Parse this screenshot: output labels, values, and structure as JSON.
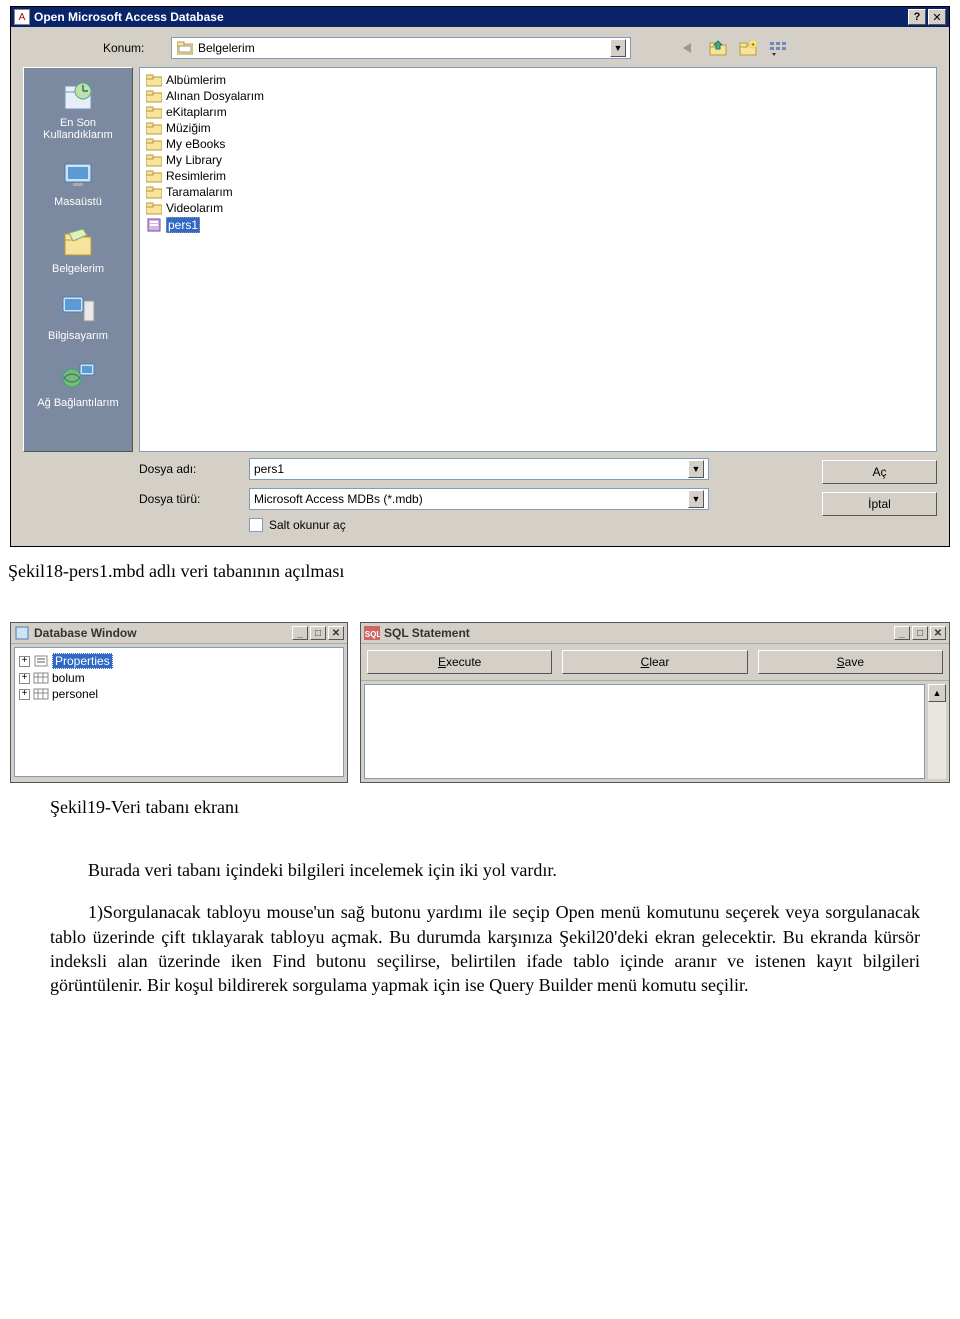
{
  "dialog": {
    "title": "Open Microsoft Access Database",
    "konum_label": "Konum:",
    "konum_value": "Belgelerim",
    "places": [
      {
        "label": "En Son Kullandıklarım"
      },
      {
        "label": "Masaüstü"
      },
      {
        "label": "Belgelerim"
      },
      {
        "label": "Bilgisayarım"
      },
      {
        "label": "Ağ Bağlantılarım"
      }
    ],
    "files": [
      {
        "name": "Albümlerim",
        "type": "folder"
      },
      {
        "name": "Alınan Dosyalarım",
        "type": "folder"
      },
      {
        "name": "eKitaplarım",
        "type": "folder"
      },
      {
        "name": "Müziğim",
        "type": "folder"
      },
      {
        "name": "My eBooks",
        "type": "folder"
      },
      {
        "name": "My Library",
        "type": "folder"
      },
      {
        "name": "Resimlerim",
        "type": "folder"
      },
      {
        "name": "Taramalarım",
        "type": "folder"
      },
      {
        "name": "Videolarım",
        "type": "folder"
      },
      {
        "name": "pers1",
        "type": "mdb",
        "selected": true
      }
    ],
    "filename_label": "Dosya adı:",
    "filename_value": "pers1",
    "filetype_label": "Dosya türü:",
    "filetype_value": "Microsoft Access MDBs (*.mdb)",
    "readonly_label": "Salt okunur aç",
    "open_btn": "Aç",
    "cancel_btn": "İptal"
  },
  "caption1": "Şekil18-pers1.mbd adlı veri tabanının açılması",
  "dbwin": {
    "title": "Database Window",
    "items": [
      {
        "label": "Properties",
        "selected": true
      },
      {
        "label": "bolum",
        "selected": false
      },
      {
        "label": "personel",
        "selected": false
      }
    ]
  },
  "sqlwin": {
    "title": "SQL Statement",
    "buttons": {
      "execute": "Execute",
      "clear": "Clear",
      "save": "Save"
    }
  },
  "caption2": "Şekil19-Veri tabanı ekranı",
  "para1": "Burada veri tabanı içindeki bilgileri incelemek için iki yol vardır.",
  "para2": "1)Sorgulanacak tabloyu mouse'un sağ butonu yardımı ile seçip Open menü komutunu seçerek veya sorgulanacak tablo üzerinde çift tıklayarak tabloyu açmak. Bu durumda karşınıza Şekil20'deki ekran gelecektir. Bu ekranda kürsör indeksli alan üzerinde iken Find butonu seçilirse, belirtilen ifade tablo içinde aranır ve istenen kayıt bilgileri görüntülenir. Bir koşul bildirerek sorgulama yapmak için ise Query Builder menü komutu seçilir."
}
